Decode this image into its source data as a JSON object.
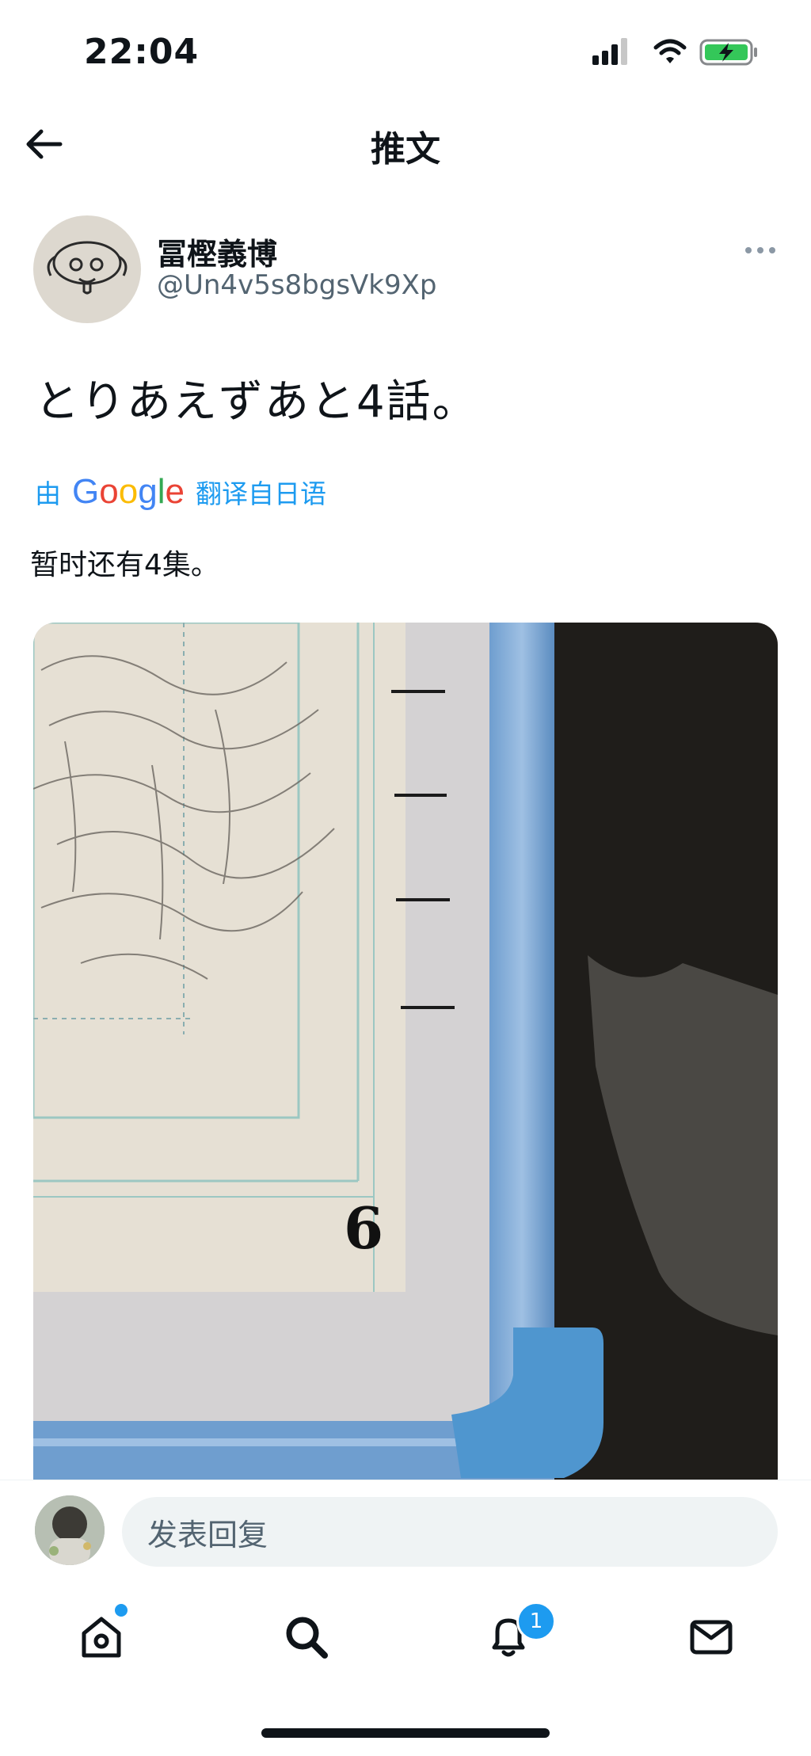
{
  "status_bar": {
    "time": "22:04"
  },
  "header": {
    "title": "推文"
  },
  "tweet": {
    "display_name": "冨樫義博",
    "handle": "@Un4v5s8bgsVk9Xp",
    "text": "とりあえずあと4話。",
    "translate": {
      "prefix": "由",
      "brand": "Google",
      "suffix": "翻译自日语"
    },
    "translated_text": "暂时还有4集。",
    "photo_caption": "6"
  },
  "reply": {
    "placeholder": "发表回复"
  },
  "tabbar": {
    "items": [
      {
        "name": "home",
        "icon": "home-icon"
      },
      {
        "name": "search",
        "icon": "search-icon"
      },
      {
        "name": "notifications",
        "icon": "bell-icon"
      },
      {
        "name": "messages",
        "icon": "mail-icon"
      }
    ],
    "notification_count": "1"
  },
  "colors": {
    "accent": "#1d9bf0",
    "text": "#0f1419",
    "secondary": "#536471"
  }
}
